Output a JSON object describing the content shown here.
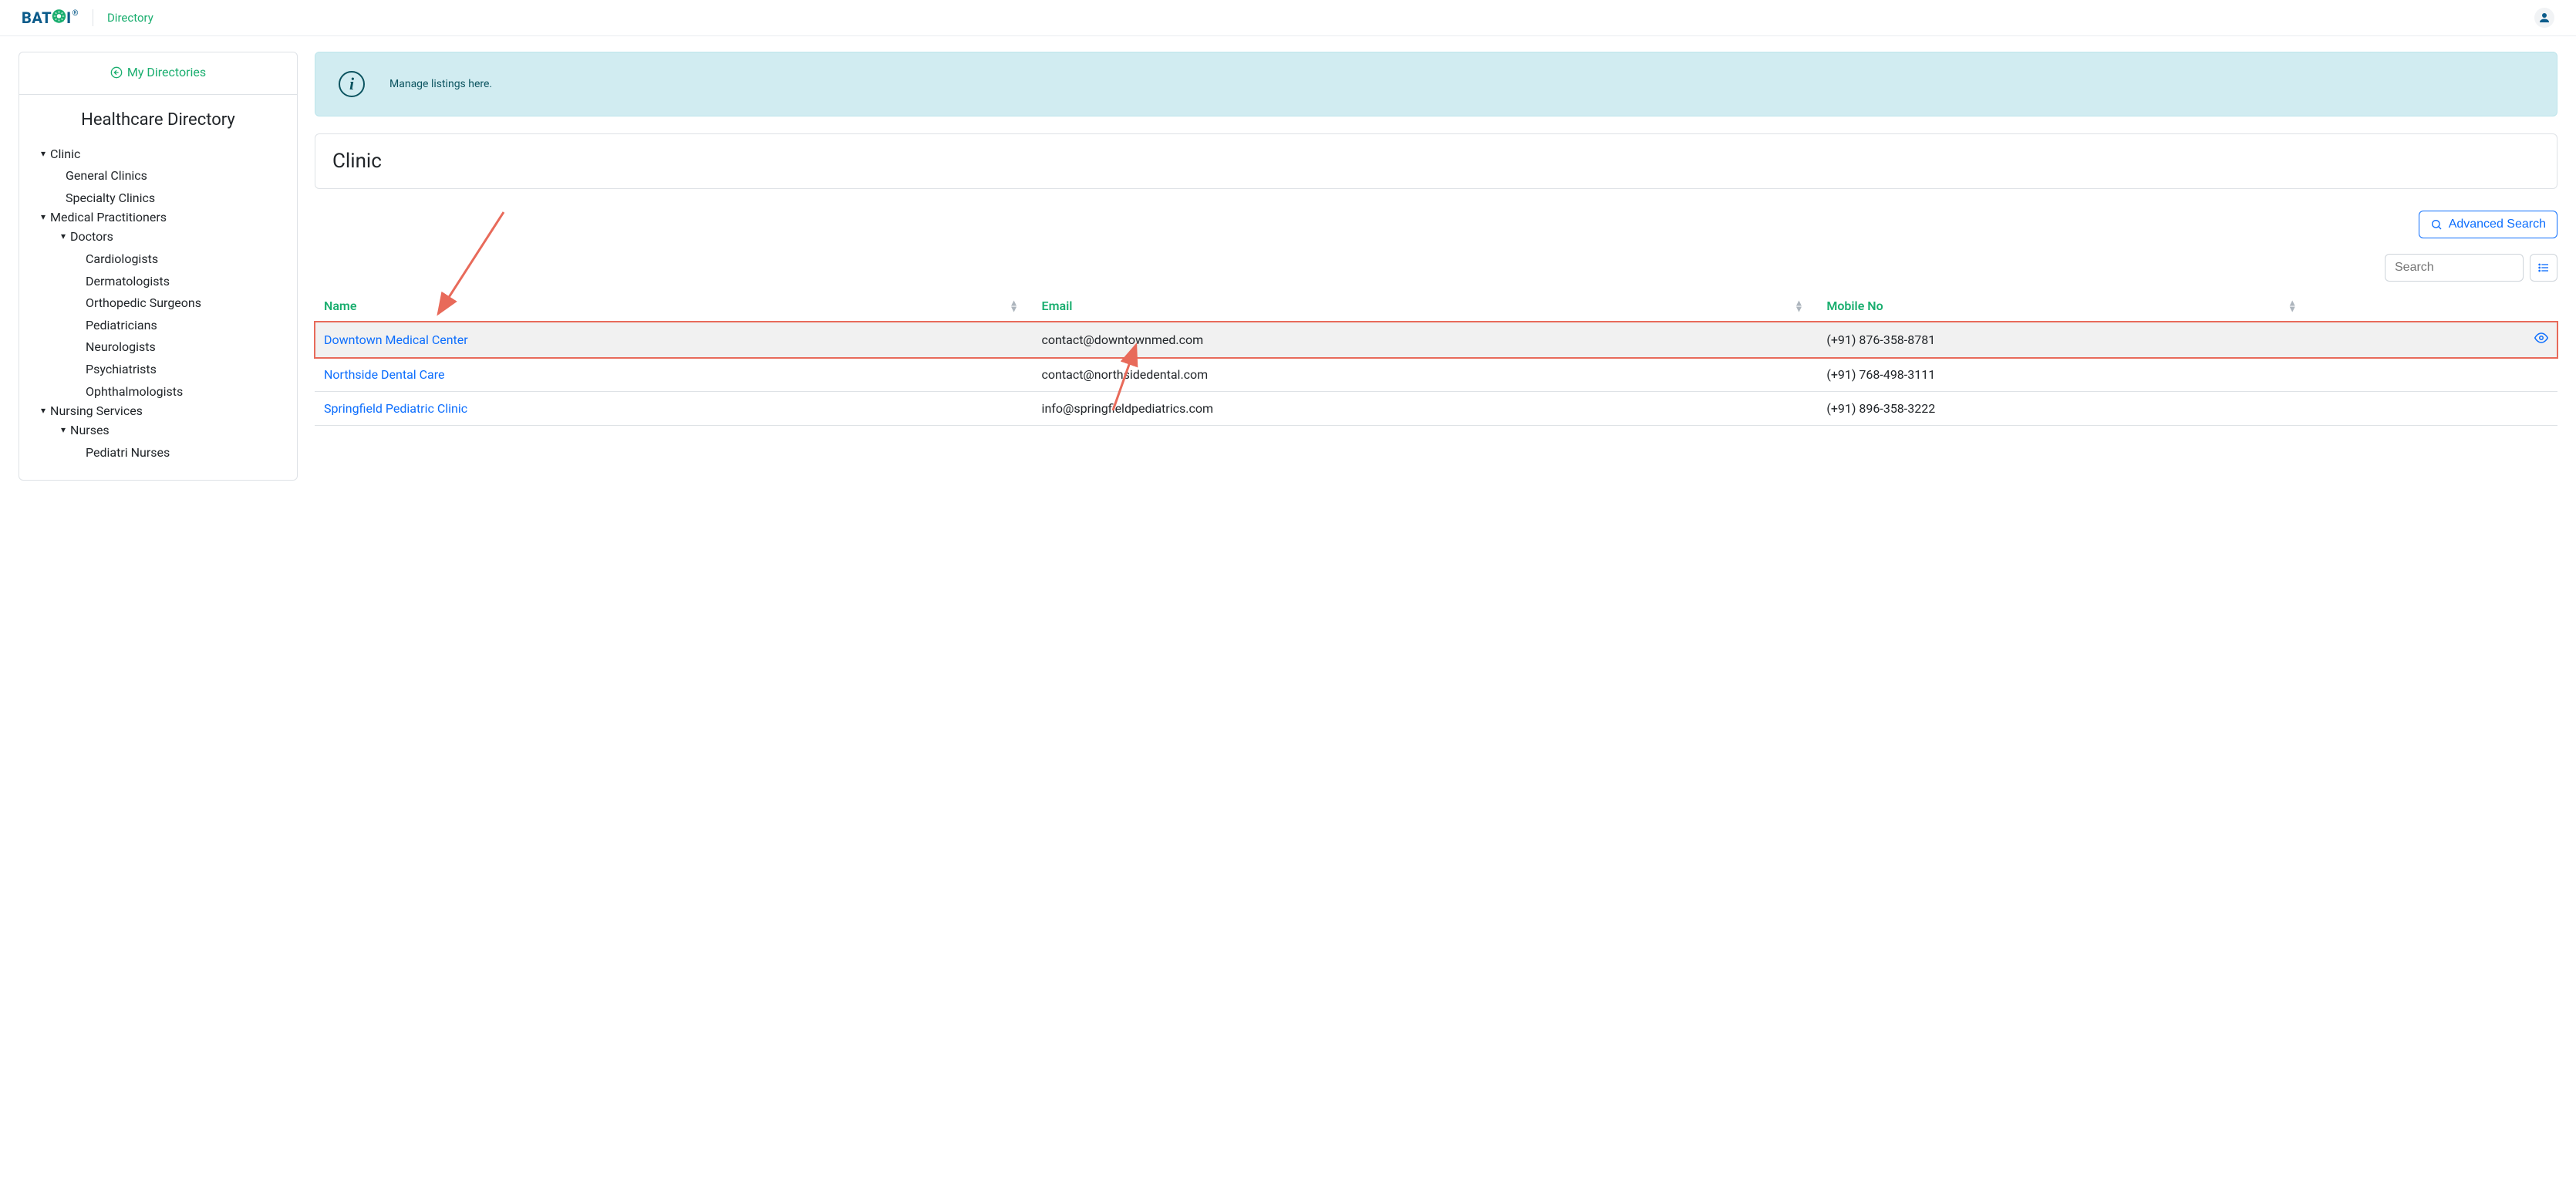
{
  "header": {
    "brand_section": "Directory"
  },
  "sidebar": {
    "my_directories": "My Directories",
    "title": "Healthcare Directory",
    "tree": [
      {
        "label": "Clinic",
        "level": 1,
        "expandable": true
      },
      {
        "label": "General Clinics",
        "level": 2,
        "expandable": false
      },
      {
        "label": "Specialty Clinics",
        "level": 2,
        "expandable": false
      },
      {
        "label": "Medical Practitioners",
        "level": 1,
        "expandable": true
      },
      {
        "label": "Doctors",
        "level": 2,
        "expandable": true
      },
      {
        "label": "Cardiologists",
        "level": 3,
        "expandable": false
      },
      {
        "label": "Dermatologists",
        "level": 3,
        "expandable": false
      },
      {
        "label": "Orthopedic Surgeons",
        "level": 3,
        "expandable": false
      },
      {
        "label": "Pediatricians",
        "level": 3,
        "expandable": false
      },
      {
        "label": "Neurologists",
        "level": 3,
        "expandable": false
      },
      {
        "label": "Psychiatrists",
        "level": 3,
        "expandable": false
      },
      {
        "label": "Ophthalmologists",
        "level": 3,
        "expandable": false
      },
      {
        "label": "Nursing Services",
        "level": 1,
        "expandable": true
      },
      {
        "label": "Nurses",
        "level": 2,
        "expandable": true
      },
      {
        "label": "Pediatri Nurses",
        "level": 3,
        "expandable": false
      }
    ]
  },
  "banner": {
    "message": "Manage listings here."
  },
  "panel": {
    "heading": "Clinic"
  },
  "toolbar": {
    "advanced_search": "Advanced Search",
    "search_placeholder": "Search"
  },
  "table": {
    "columns": {
      "name": "Name",
      "email": "Email",
      "mobile": "Mobile No"
    },
    "rows": [
      {
        "name": "Downtown Medical Center",
        "email": "contact@downtownmed.com",
        "mobile": "(+91) 876-358-8781",
        "highlighted": true,
        "show_eye": true
      },
      {
        "name": "Northside Dental Care",
        "email": "contact@northsidedental.com",
        "mobile": "(+91) 768-498-3111",
        "highlighted": false,
        "show_eye": false
      },
      {
        "name": "Springfield Pediatric Clinic",
        "email": "info@springfieldpediatrics.com",
        "mobile": "(+91) 896-358-3222",
        "highlighted": false,
        "show_eye": false
      }
    ]
  }
}
